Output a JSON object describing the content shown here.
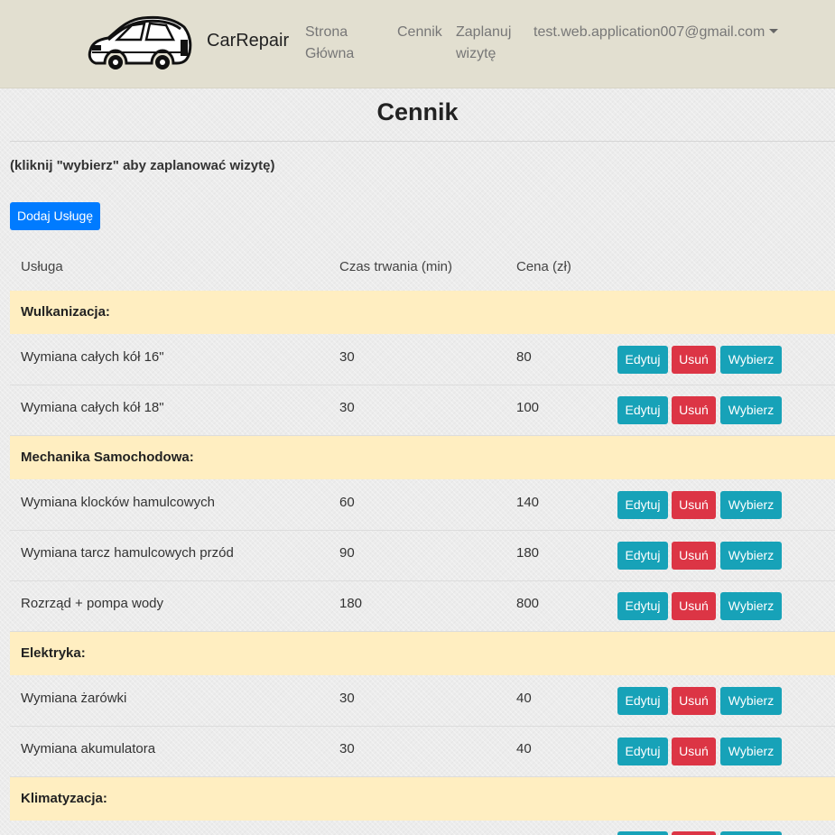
{
  "navbar": {
    "brand": "CarRepair",
    "links": {
      "home": "Strona Główna",
      "pricing": "Cennik",
      "schedule": "Zaplanuj wizytę"
    },
    "user_email": "test.web.application007@gmail.com"
  },
  "page": {
    "title": "Cennik",
    "hint": "(kliknij \"wybierz\" aby zaplanować wizytę)",
    "add_button": "Dodaj Usługę"
  },
  "table": {
    "headers": {
      "service": "Usługa",
      "duration": "Czas trwania (min)",
      "price": "Cena (zł)"
    },
    "buttons": {
      "edit": "Edytuj",
      "delete": "Usuń",
      "select": "Wybierz"
    },
    "categories": [
      {
        "name": "Wulkanizacja:",
        "rows": [
          {
            "service": "Wymiana całych kół 16\"",
            "duration": "30",
            "price": "80"
          },
          {
            "service": "Wymiana całych kół 18\"",
            "duration": "30",
            "price": "100"
          }
        ]
      },
      {
        "name": "Mechanika Samochodowa:",
        "rows": [
          {
            "service": "Wymiana klocków hamulcowych",
            "duration": "60",
            "price": "140"
          },
          {
            "service": "Wymiana tarcz hamulcowych przód",
            "duration": "90",
            "price": "180"
          },
          {
            "service": "Rozrząd + pompa wody",
            "duration": "180",
            "price": "800"
          }
        ]
      },
      {
        "name": "Elektryka:",
        "rows": [
          {
            "service": "Wymiana żarówki",
            "duration": "30",
            "price": "40"
          },
          {
            "service": "Wymiana akumulatora",
            "duration": "30",
            "price": "40"
          }
        ]
      },
      {
        "name": "Klimatyzacja:",
        "rows": []
      }
    ]
  },
  "colors": {
    "navbar_bg": "#e2dfd0",
    "primary": "#007bff",
    "info": "#17a2b8",
    "danger": "#dc3545",
    "category_bg": "#ffeec1"
  }
}
